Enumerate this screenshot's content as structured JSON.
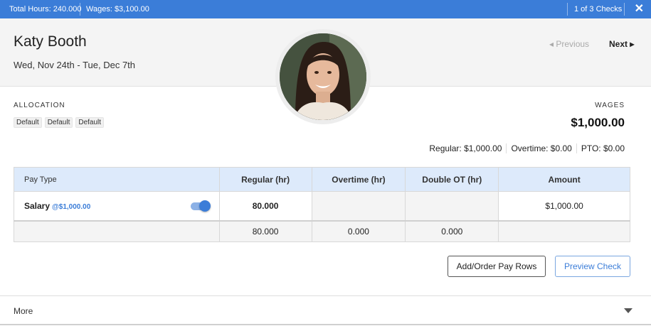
{
  "topbar": {
    "total_hours": "Total Hours: 240.000",
    "wages": "Wages: $3,100.00",
    "check_count": "1 of 3 Checks",
    "close_glyph": "✕"
  },
  "employee": {
    "name": "Katy Booth",
    "date_range": "Wed, Nov 24th - Tue, Dec 7th"
  },
  "nav": {
    "previous": "◂ Previous",
    "next": "Next ▸"
  },
  "allocation": {
    "label": "ALLOCATION",
    "chips": [
      "Default",
      "Default",
      "Default"
    ]
  },
  "wages": {
    "label": "WAGES",
    "total": "$1,000.00",
    "regular": "Regular: $1,000.00",
    "overtime": "Overtime: $0.00",
    "pto": "PTO: $0.00"
  },
  "table": {
    "headers": [
      "Pay Type",
      "Regular (hr)",
      "Overtime (hr)",
      "Double OT (hr)",
      "Amount"
    ],
    "rows": [
      {
        "pay_type": "Salary",
        "rate": "@$1,000.00",
        "enabled": true,
        "regular": "80.000",
        "overtime": "",
        "double_ot": "",
        "amount": "$1,000.00"
      }
    ],
    "totals": {
      "regular": "80.000",
      "overtime": "0.000",
      "double_ot": "0.000"
    }
  },
  "buttons": {
    "add_order": "Add/Order Pay Rows",
    "preview": "Preview Check"
  },
  "more": {
    "label": "More"
  },
  "colors": {
    "accent": "#3b7dd8",
    "header_bg": "#f4f4f4",
    "table_header_bg": "#ddeafb"
  },
  "icons": [
    "close-icon",
    "chevron-left-icon",
    "chevron-right-icon",
    "toggle-switch",
    "chevron-down-icon",
    "avatar-photo"
  ]
}
